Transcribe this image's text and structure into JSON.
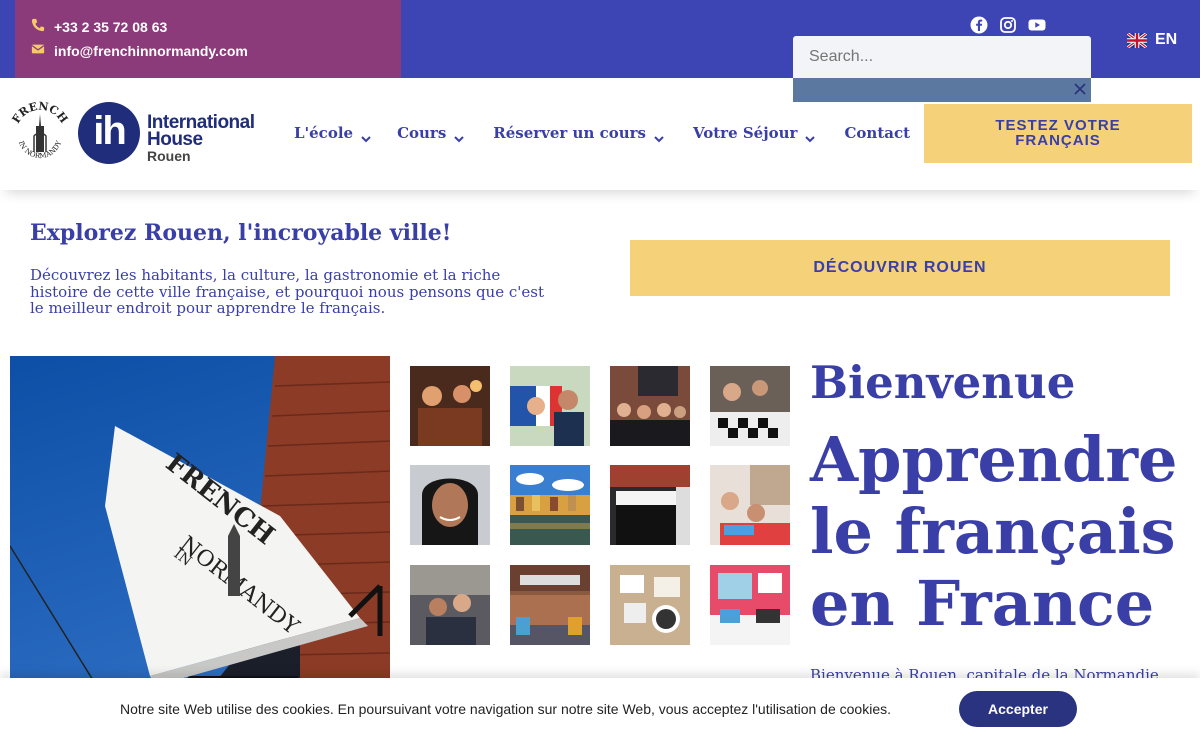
{
  "topbar": {
    "phone": "+33 2 35 72 08 63",
    "email": "info@frenchinnormandy.com",
    "phone_icon": "phone-icon",
    "email_icon": "envelope-icon",
    "socials": [
      "facebook-icon",
      "instagram-icon",
      "youtube-icon"
    ],
    "language": "EN",
    "colors": {
      "bar": "#3d44b4",
      "contact_box": "#8b3a7a"
    }
  },
  "search": {
    "placeholder": "Search..."
  },
  "logo": {
    "fin_arc": "FRENCH",
    "fin_arc_bottom": "IN NORMANDY",
    "ih_mark": "ih",
    "line1": "International",
    "line2": "House",
    "line3": "Rouen"
  },
  "nav": {
    "items": [
      {
        "label": "L'école",
        "has_dropdown": true
      },
      {
        "label": "Cours",
        "has_dropdown": true
      },
      {
        "label": "Réserver un cours",
        "has_dropdown": true
      },
      {
        "label": "Votre Séjour",
        "has_dropdown": true
      },
      {
        "label": "Contact",
        "has_dropdown": false
      }
    ],
    "cta_line1": "TESTEZ VOTRE",
    "cta_line2": "FRANÇAIS"
  },
  "explore": {
    "title": "Explorez Rouen, l'incroyable ville!",
    "text_line1": "Découvrez les habitants, la culture, la gastronomie et la riche",
    "text_line2": "histoire de cette ville française, et pourquoi nous pensons que c'est",
    "text_line3": "le meilleur endroit pour apprendre le français.",
    "cta": "DÉCOUVRIR ROUEN"
  },
  "hero": {
    "sign_top": "FRENCH",
    "sign_bottom": "NORMANDY",
    "sign_in": "IN"
  },
  "welcome": {
    "greeting": "Bienvenue",
    "title_line1": "Apprendre",
    "title_line2": "le français",
    "title_line3": "en France",
    "intro": "Bienvenue à Rouen, capitale de la Normandie"
  },
  "cookie": {
    "text": "Notre site Web utilise des cookies. En poursuivant votre navigation sur notre site Web, vous acceptez l'utilisation de cookies.",
    "button": "Accepter"
  },
  "accent": {
    "blue": "#3a3fa8",
    "yellow": "#f5d27a",
    "navy": "#2a3380"
  }
}
